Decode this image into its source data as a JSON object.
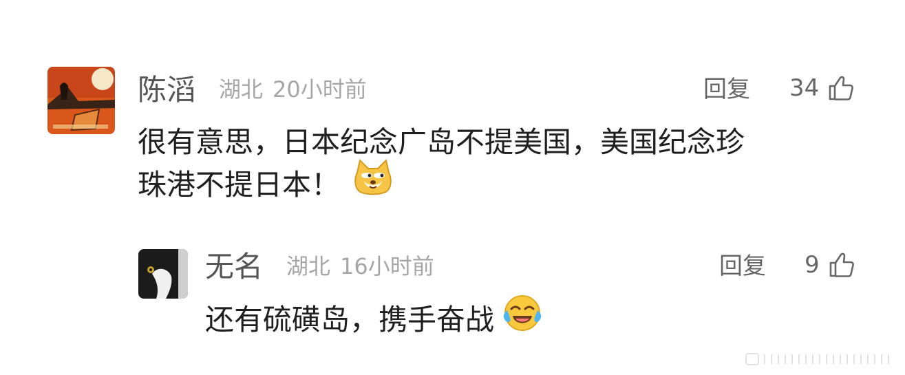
{
  "comments": [
    {
      "author": "陈滔",
      "location": "湖北",
      "time": "20小时前",
      "reply_label": "回复",
      "likes": "34",
      "text_line1": "很有意思，日本纪念广岛不提美国，美国纪念珍",
      "text_line2": "珠港不提日本！",
      "emoji": "doge-emoji"
    },
    {
      "author": "无名",
      "location": "湖北",
      "time": "16小时前",
      "reply_label": "回复",
      "likes": "9",
      "text": "还有硫磺岛，携手奋战",
      "emoji": "laugh-cry-emoji"
    }
  ],
  "icons": {
    "like": "thumbs-up-icon"
  }
}
